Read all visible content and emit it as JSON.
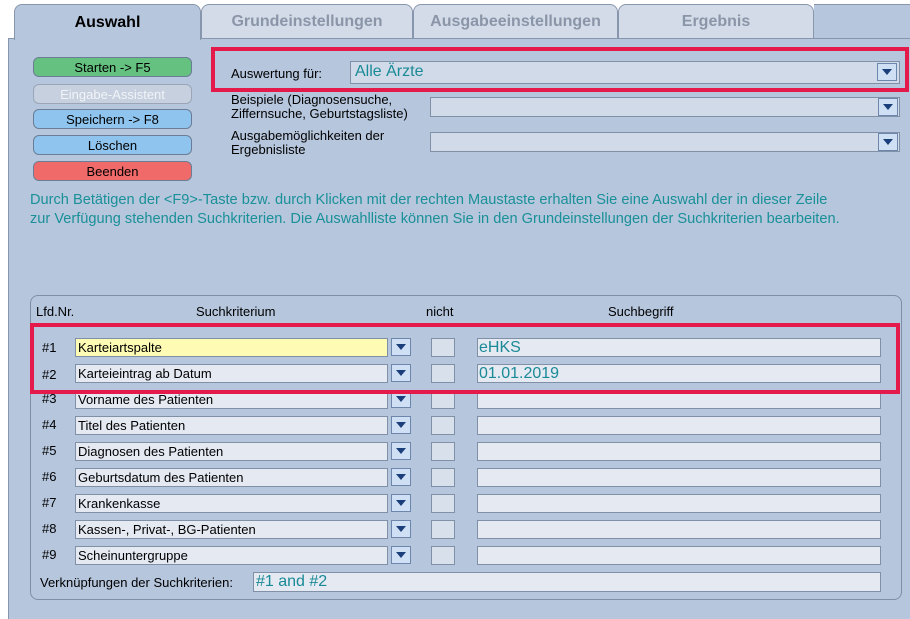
{
  "tabs": [
    "Auswahl",
    "Grundeinstellungen",
    "Ausgabeeinstellungen",
    "Ergebnis"
  ],
  "buttons": {
    "starten": {
      "label": "Starten -> F5"
    },
    "assistent": {
      "label": "Eingabe-Assistent"
    },
    "speichern": {
      "label": "Speichern -> F8"
    },
    "loeschen": {
      "label": "Löschen"
    },
    "beenden": {
      "label": "Beenden"
    }
  },
  "auswertung": {
    "label": "Auswertung für:",
    "value": "Alle Ärzte"
  },
  "beispiele": {
    "label_line1": "Beispiele (Diagnosensuche,",
    "label_line2": "Ziffernsuche, Geburtstagsliste)",
    "value": ""
  },
  "ausgabe": {
    "label_line1": "Ausgabemöglichkeiten der",
    "label_line2": "Ergebnisliste",
    "value": ""
  },
  "info": {
    "line1": "Durch Betätigen der <F9>-Taste bzw. durch Klicken mit der rechten Maustaste erhalten Sie eine Auswahl der in dieser Zeile",
    "line2": "zur Verfügung stehenden Suchkriterien. Die Auswahlliste können Sie in den Grundeinstellungen der Suchkriterien bearbeiten."
  },
  "table": {
    "headers": {
      "nr": "Lfd.Nr.",
      "kriterium": "Suchkriterium",
      "nicht": "nicht",
      "begriff": "Suchbegriff"
    },
    "rows": [
      {
        "nr": "#1",
        "kriterium": "Karteiartspalte",
        "begriff": "eHKS"
      },
      {
        "nr": "#2",
        "kriterium": "Karteieintrag ab Datum",
        "begriff": "01.01.2019"
      },
      {
        "nr": "#3",
        "kriterium": "Vorname des Patienten",
        "begriff": ""
      },
      {
        "nr": "#4",
        "kriterium": "Titel des Patienten",
        "begriff": ""
      },
      {
        "nr": "#5",
        "kriterium": "Diagnosen des Patienten",
        "begriff": ""
      },
      {
        "nr": "#6",
        "kriterium": "Geburtsdatum des Patienten",
        "begriff": ""
      },
      {
        "nr": "#7",
        "kriterium": "Krankenkasse",
        "begriff": ""
      },
      {
        "nr": "#8",
        "kriterium": "Kassen-, Privat-, BG-Patienten",
        "begriff": ""
      },
      {
        "nr": "#9",
        "kriterium": "Scheinuntergruppe",
        "begriff": ""
      }
    ]
  },
  "verknuepfung": {
    "label": "Verknüpfungen der Suchkriterien:",
    "value": "#1 and #2"
  },
  "colors": {
    "panel": "#b6c6dd",
    "highlight": "#e41a4a",
    "value_text": "#1a8a96"
  }
}
